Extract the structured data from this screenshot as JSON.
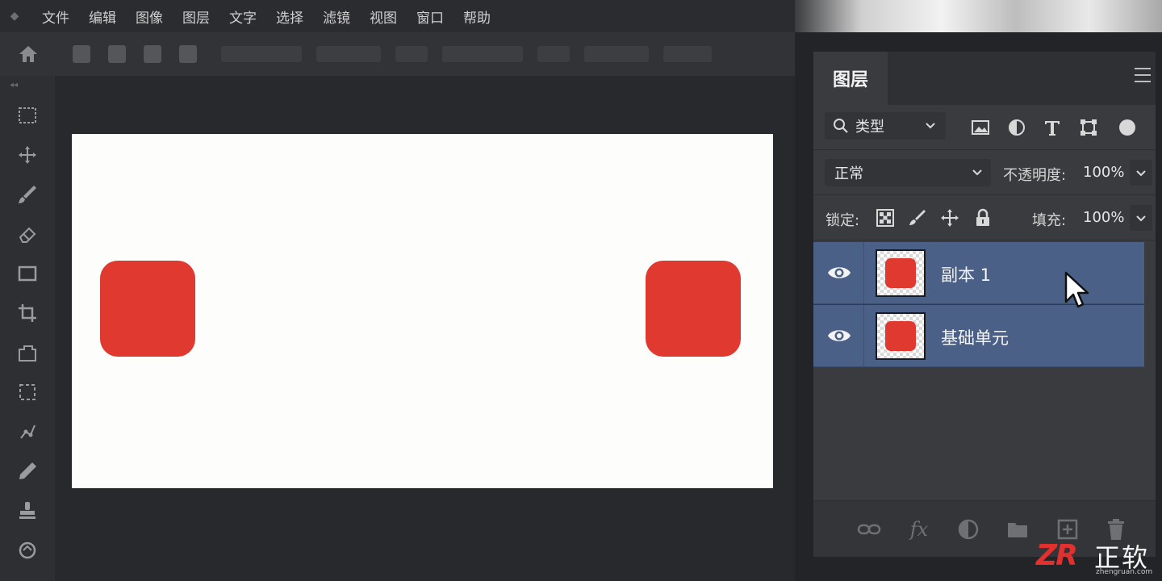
{
  "menubar": {
    "items": [
      "文件",
      "编辑",
      "图像",
      "图层",
      "文字",
      "选择",
      "滤镜",
      "视图",
      "窗口",
      "帮助"
    ]
  },
  "layers_panel": {
    "tab_label": "图层",
    "filter": {
      "selected": "类型"
    },
    "blend_mode": {
      "selected": "正常"
    },
    "opacity": {
      "label": "不透明度:",
      "value": "100%"
    },
    "lock": {
      "label": "锁定:"
    },
    "fill": {
      "label": "填充:",
      "value": "100%"
    },
    "layers": [
      {
        "name": "副本 1",
        "visible": true,
        "selected": true
      },
      {
        "name": "基础单元",
        "visible": true,
        "selected": true
      }
    ]
  },
  "canvas": {
    "shape_color": "#e03a30",
    "background_color": "#fdfdfc"
  },
  "watermark": {
    "logo": "ZR",
    "text": "正软",
    "sub": "zhengruan.com"
  },
  "colors": {
    "selection": "#4b6087",
    "panel": "#3a3b3e",
    "accent_red": "#e03a30"
  }
}
